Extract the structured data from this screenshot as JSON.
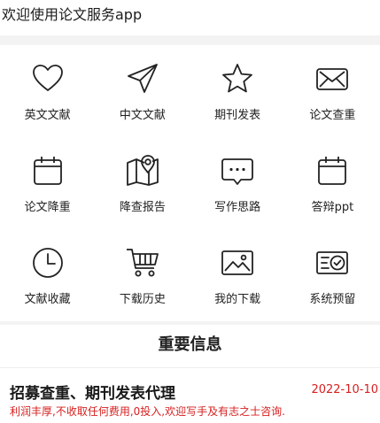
{
  "header": {
    "welcome": "欢迎使用论文服务app"
  },
  "menu": [
    {
      "label": "英文文献",
      "icon": "heart-icon"
    },
    {
      "label": "中文文献",
      "icon": "paper-plane-icon"
    },
    {
      "label": "期刊发表",
      "icon": "star-icon"
    },
    {
      "label": "论文查重",
      "icon": "envelope-icon"
    },
    {
      "label": "论文降重",
      "icon": "calendar-icon"
    },
    {
      "label": "降查报告",
      "icon": "map-location-icon"
    },
    {
      "label": "写作思路",
      "icon": "chat-bubble-icon"
    },
    {
      "label": "答辩ppt",
      "icon": "calendar-icon"
    },
    {
      "label": "文献收藏",
      "icon": "clock-icon"
    },
    {
      "label": "下载历史",
      "icon": "shopping-cart-icon"
    },
    {
      "label": "我的下载",
      "icon": "image-icon"
    },
    {
      "label": "系统预留",
      "icon": "verified-badge-icon"
    }
  ],
  "section": {
    "title": "重要信息"
  },
  "news": {
    "title": "招募查重、期刊发表代理",
    "date": "2022-10-10",
    "description": "利润丰厚,不收取任何费用,0投入,欢迎写手及有志之士咨询."
  },
  "colors": {
    "accent_red": "#d61f1f",
    "icon_stroke": "#222222",
    "band_gray": "#f3f3f3"
  }
}
